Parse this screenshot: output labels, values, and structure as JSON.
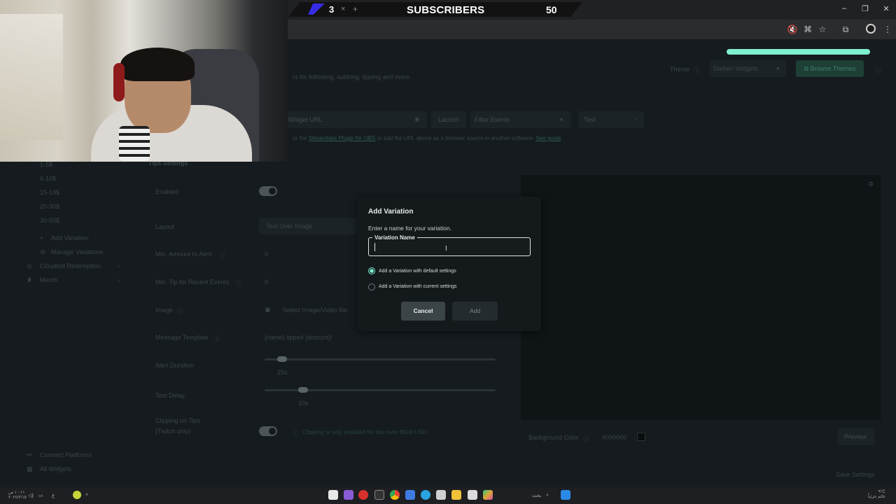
{
  "overlay": {
    "count": "3",
    "separator": "×",
    "plus": "+",
    "label": "SUBSCRIBERS",
    "goal": "50"
  },
  "window_controls": {
    "minimize": "–",
    "restore": "❐",
    "close": "✕"
  },
  "toolbar_icons": [
    "mute-icon",
    "translate-icon",
    "star-icon",
    "extensions-icon",
    "profile-icon",
    "menu-icon"
  ],
  "header": {
    "subtitle": "rs for following, subbing, tipping and more.",
    "theme_label": "Theme",
    "theme_value": "Darken Widgets",
    "browse_themes": "Browse Themes"
  },
  "widget_bar": {
    "url_label": "Widget URL",
    "launch": "Launch",
    "filter_events": "Filter Events",
    "test": "Test",
    "help_prefix": "or the",
    "help_link": "Streamlabs Plugin for OBS",
    "help_suffix": "or add the URL above as a browser source in another software.",
    "see_guide": "See guide"
  },
  "sidebar": {
    "items": [
      "1-5$",
      "6-10$",
      "15-19$",
      "20-30$",
      "30-50$"
    ],
    "add_variation": "Add Variation",
    "manage_variations": "Manage Variations",
    "cloudbot": "Cloudbot Redemption",
    "merch": "Merch",
    "connect_platforms": "Connect Platforms",
    "all_widgets": "All Widgets"
  },
  "settings": {
    "section_title": "Tips Settings",
    "enabled": "Enabled",
    "layout": "Layout",
    "layout_value": "Text Over Image",
    "min_amount": "Min. Amount to Alert",
    "min_amount_value": "0",
    "min_tip": "Min. Tip for Recent Events",
    "min_tip_value": "0",
    "image": "Image",
    "image_value": "Select Image/Video file",
    "message_template": "Message Template",
    "message_template_value": "{name} tipped {amount}!",
    "alert_duration": "Alert Duration",
    "alert_duration_value": "25s",
    "text_delay": "Text Delay",
    "text_delay_value": "10s",
    "clipping": "Clipping on Tips",
    "clipping_sub": "(Twitch only)",
    "clipping_note": "Clipping is only enabled for tips over $500 USD"
  },
  "preview": {
    "background_color_label": "Background Color",
    "background_color_value": "#000000",
    "preview_button": "Preview",
    "save_settings": "Save Settings"
  },
  "modal": {
    "title": "Add Variation",
    "description": "Enter a name for your variation.",
    "field_label": "Variation Name",
    "field_value": "",
    "option_default": "Add a Variation with default settings",
    "option_current": "Add a Variation with current settings",
    "selected_option": "default",
    "cancel": "Cancel",
    "add": "Add"
  },
  "taskbar": {
    "left_text": "١٠:١١ ص",
    "left_date": "٢٠٢٤/٢/١٥",
    "search_text": "بحث",
    "weather": "٩°C",
    "weather_sub": "غائم جزئياً"
  },
  "colors": {
    "accent": "#7ff0d0",
    "page_bg": "#151b1e",
    "modal_bg": "#141a1c"
  }
}
